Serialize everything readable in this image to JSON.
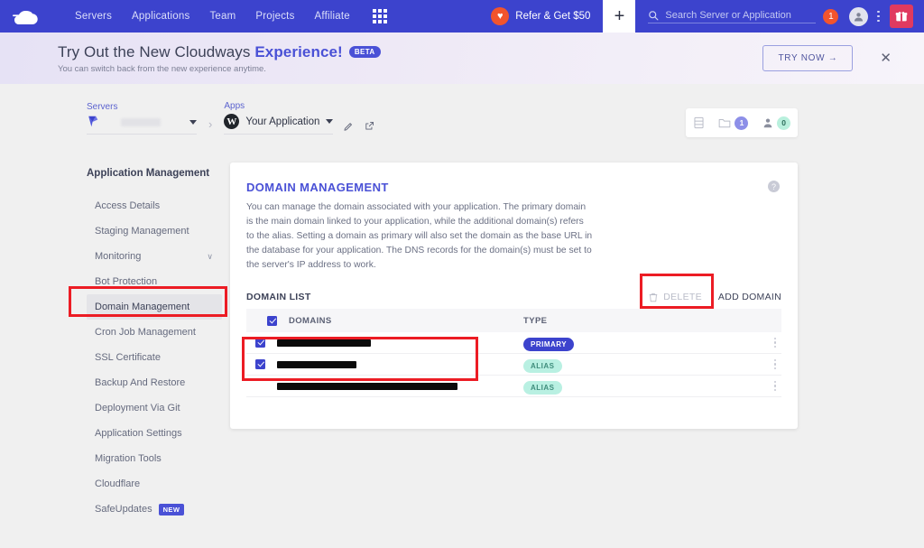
{
  "topnav": {
    "logo_name": "cloudways-logo",
    "links": [
      "Servers",
      "Applications",
      "Team",
      "Projects",
      "Affiliate"
    ],
    "apps_grid_icon": "grid-apps-icon",
    "refer_label": "Refer & Get $50",
    "heart_icon": "heart-icon",
    "plus_icon": "plus-icon",
    "search_icon": "search-icon",
    "search_placeholder": "Search Server or Application",
    "search_value": "",
    "notification_count": "1",
    "avatar_icon": "user-avatar-icon",
    "kebab_icon": "kebab-menu-icon",
    "gift_icon": "gift-icon"
  },
  "banner": {
    "title_plain": "Try Out the New Cloudways ",
    "title_accent": "Experience!",
    "beta_label": "BETA",
    "subtitle": "You can switch back from the new experience anytime.",
    "cta_label": "TRY NOW →",
    "close_icon": "close-icon"
  },
  "breadcrumb": {
    "servers_label": "Servers",
    "server_name": "",
    "server_icon": "server-logo-icon",
    "separator": "›",
    "apps_label": "Apps",
    "app_icon": "wordpress-icon",
    "app_name": "Your Application",
    "edit_icon": "pencil-edit-icon",
    "launch_icon": "external-link-icon",
    "caret_icon": "caret-down-icon"
  },
  "stats": {
    "list_icon": "server-list-icon",
    "folder_icon": "folder-icon",
    "folder_count": "1",
    "user_icon": "user-icon",
    "user_count": "0"
  },
  "sidebar": {
    "title": "Application Management",
    "items": [
      {
        "label": "Access Details",
        "active": false,
        "chevron": false,
        "badge": ""
      },
      {
        "label": "Staging Management",
        "active": false,
        "chevron": false,
        "badge": ""
      },
      {
        "label": "Monitoring",
        "active": false,
        "chevron": true,
        "badge": ""
      },
      {
        "label": "Bot Protection",
        "active": false,
        "chevron": false,
        "badge": ""
      },
      {
        "label": "Domain Management",
        "active": true,
        "chevron": false,
        "badge": ""
      },
      {
        "label": "Cron Job Management",
        "active": false,
        "chevron": false,
        "badge": ""
      },
      {
        "label": "SSL Certificate",
        "active": false,
        "chevron": false,
        "badge": ""
      },
      {
        "label": "Backup And Restore",
        "active": false,
        "chevron": false,
        "badge": ""
      },
      {
        "label": "Deployment Via Git",
        "active": false,
        "chevron": false,
        "badge": ""
      },
      {
        "label": "Application Settings",
        "active": false,
        "chevron": false,
        "badge": ""
      },
      {
        "label": "Migration Tools",
        "active": false,
        "chevron": false,
        "badge": ""
      },
      {
        "label": "Cloudflare",
        "active": false,
        "chevron": false,
        "badge": ""
      },
      {
        "label": "SafeUpdates",
        "active": false,
        "chevron": false,
        "badge": "NEW"
      }
    ]
  },
  "card": {
    "title": "DOMAIN MANAGEMENT",
    "help_icon": "help-question-icon",
    "description": "You can manage the domain associated with your application. The primary domain is the main domain linked to your application, while the additional domain(s) refers to the alias. Setting a domain as primary will also set the domain as the base URL in the database for your application. The DNS records for the domain(s) must be set to the server's IP address to work.",
    "list_title": "DOMAIN LIST",
    "delete_label": "DELETE",
    "delete_icon": "trash-icon",
    "add_label": "ADD DOMAIN",
    "columns": [
      "DOMAINS",
      "TYPE"
    ],
    "header_checkbox_checked": true,
    "rows": [
      {
        "domain": "",
        "redacted": true,
        "redact_width": 104,
        "type": "PRIMARY",
        "type_style": "primary",
        "checkbox": true,
        "checked": true
      },
      {
        "domain": "",
        "redacted": true,
        "redact_width": 88,
        "type": "ALIAS",
        "type_style": "alias",
        "checkbox": true,
        "checked": true
      },
      {
        "domain": "",
        "redacted": true,
        "redact_width": 200,
        "type": "ALIAS",
        "type_style": "alias",
        "checkbox": false,
        "checked": false
      }
    ],
    "row_menu_icon": "row-kebab-icon"
  },
  "annotations": {
    "color": "#ec1c24",
    "boxes": [
      "sidebar-domain-management",
      "delete-button",
      "selected-domain-rows"
    ]
  }
}
